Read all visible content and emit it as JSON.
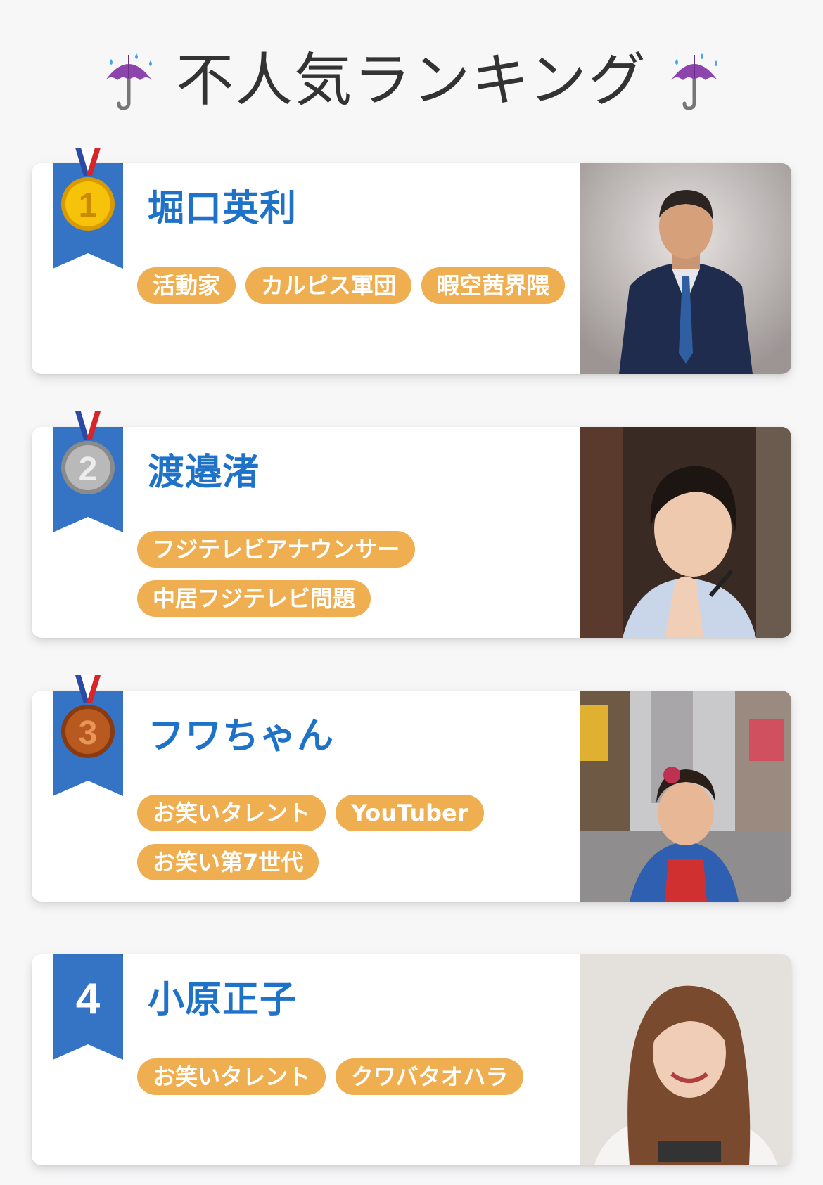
{
  "header": {
    "title": "不人気ランキング",
    "left_icon": "umbrella-rain-icon",
    "right_icon": "umbrella-rain-icon"
  },
  "colors": {
    "background": "#f7f7f8",
    "name": "#1e72c8",
    "tag": "#efae50",
    "ribbon": "#3574c4",
    "gold": "#f2b705",
    "silver": "#a8a8a8",
    "bronze": "#b5541c"
  },
  "rankings": [
    {
      "rank": "1",
      "badge": "gold-medal-icon",
      "name": "堀口英利",
      "tags": [
        "活動家",
        "カルピス軍団",
        "暇空茜界隈"
      ]
    },
    {
      "rank": "2",
      "badge": "silver-medal-icon",
      "name": "渡邉渚",
      "tags": [
        "フジテレビアナウンサー",
        "中居フジテレビ問題"
      ]
    },
    {
      "rank": "3",
      "badge": "bronze-medal-icon",
      "name": "フワちゃん",
      "tags": [
        "お笑いタレント",
        "YouTuber",
        "お笑い第7世代"
      ]
    },
    {
      "rank": "4",
      "badge": "rank-number",
      "name": "小原正子",
      "tags": [
        "お笑いタレント",
        "クワバタオハラ"
      ]
    }
  ]
}
